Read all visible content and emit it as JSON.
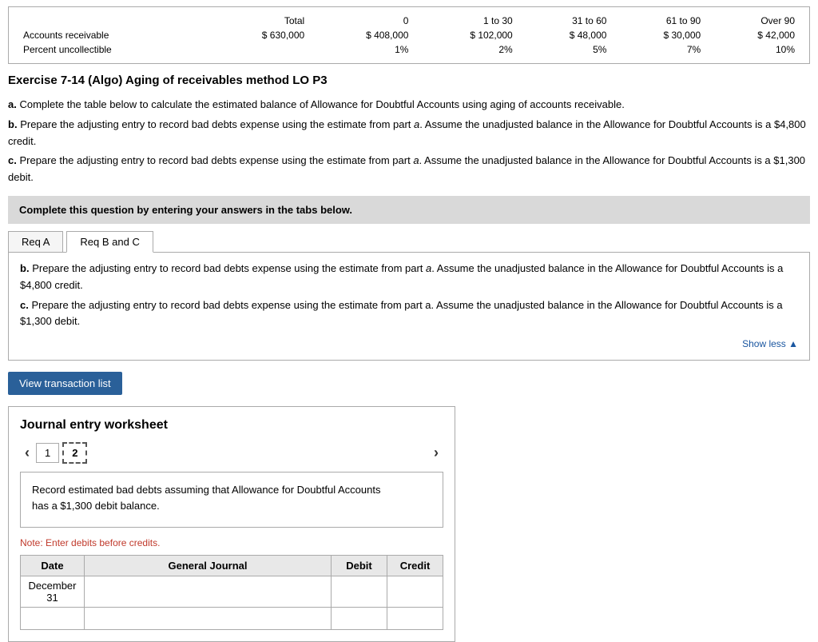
{
  "top_table": {
    "headers": [
      "",
      "Total",
      "0",
      "1 to 30",
      "31 to 60",
      "61 to 90",
      "Over 90"
    ],
    "rows": [
      {
        "label": "Accounts receivable",
        "total": "$ 630,000",
        "col0": "$ 408,000",
        "col1to30": "$ 102,000",
        "col31to60": "$ 48,000",
        "col61to90": "$ 30,000",
        "over90": "$ 42,000"
      },
      {
        "label": "Percent uncollectible",
        "total": "",
        "col0": "1%",
        "col1to30": "2%",
        "col31to60": "5%",
        "col61to90": "7%",
        "over90": "10%"
      }
    ]
  },
  "exercise": {
    "title": "Exercise 7-14 (Algo) Aging of receivables method LO P3",
    "instructions": {
      "preamble_a": "a. Complete the table below to calculate the estimated balance of Allowance for Doubtful Accounts using aging of accounts receivable.",
      "preamble_b": "b. Prepare the adjusting entry to record bad debts expense using the estimate from part a. Assume the unadjusted balance in the Allowance for Doubtful Accounts is a $4,800 credit.",
      "preamble_c": "c. Prepare the adjusting entry to record bad debts expense using the estimate from part a. Assume the unadjusted balance in the Allowance for Doubtful Accounts is a $1,300 debit."
    }
  },
  "complete_box": {
    "text": "Complete this question by entering your answers in the tabs below."
  },
  "tabs": {
    "tab1_label": "Req A",
    "tab2_label": "Req B and C"
  },
  "req_bc": {
    "text_b": "b. Prepare the adjusting entry to record bad debts expense using the estimate from part a. Assume the unadjusted balance in the Allowance for Doubtful Accounts is a $4,800 credit.",
    "text_c": "c. Prepare the adjusting entry to record bad debts expense using the estimate from part a. Assume the unadjusted balance in the Allowance for Doubtful Accounts is a $1,300 debit.",
    "show_less": "Show less ▲"
  },
  "view_transaction_btn": "View transaction list",
  "journal": {
    "title": "Journal entry worksheet",
    "pages": [
      "1",
      "2"
    ],
    "active_page": "2",
    "record_text_line1": "Record estimated bad debts assuming that Allowance for Doubtful Accounts",
    "record_text_line2": "has a $1,300 debit balance.",
    "note": "Note: Enter debits before credits.",
    "table": {
      "headers": [
        "Date",
        "General Journal",
        "Debit",
        "Credit"
      ],
      "rows": [
        {
          "date": "December\n31",
          "general_journal": "",
          "debit": "",
          "credit": ""
        }
      ]
    }
  }
}
